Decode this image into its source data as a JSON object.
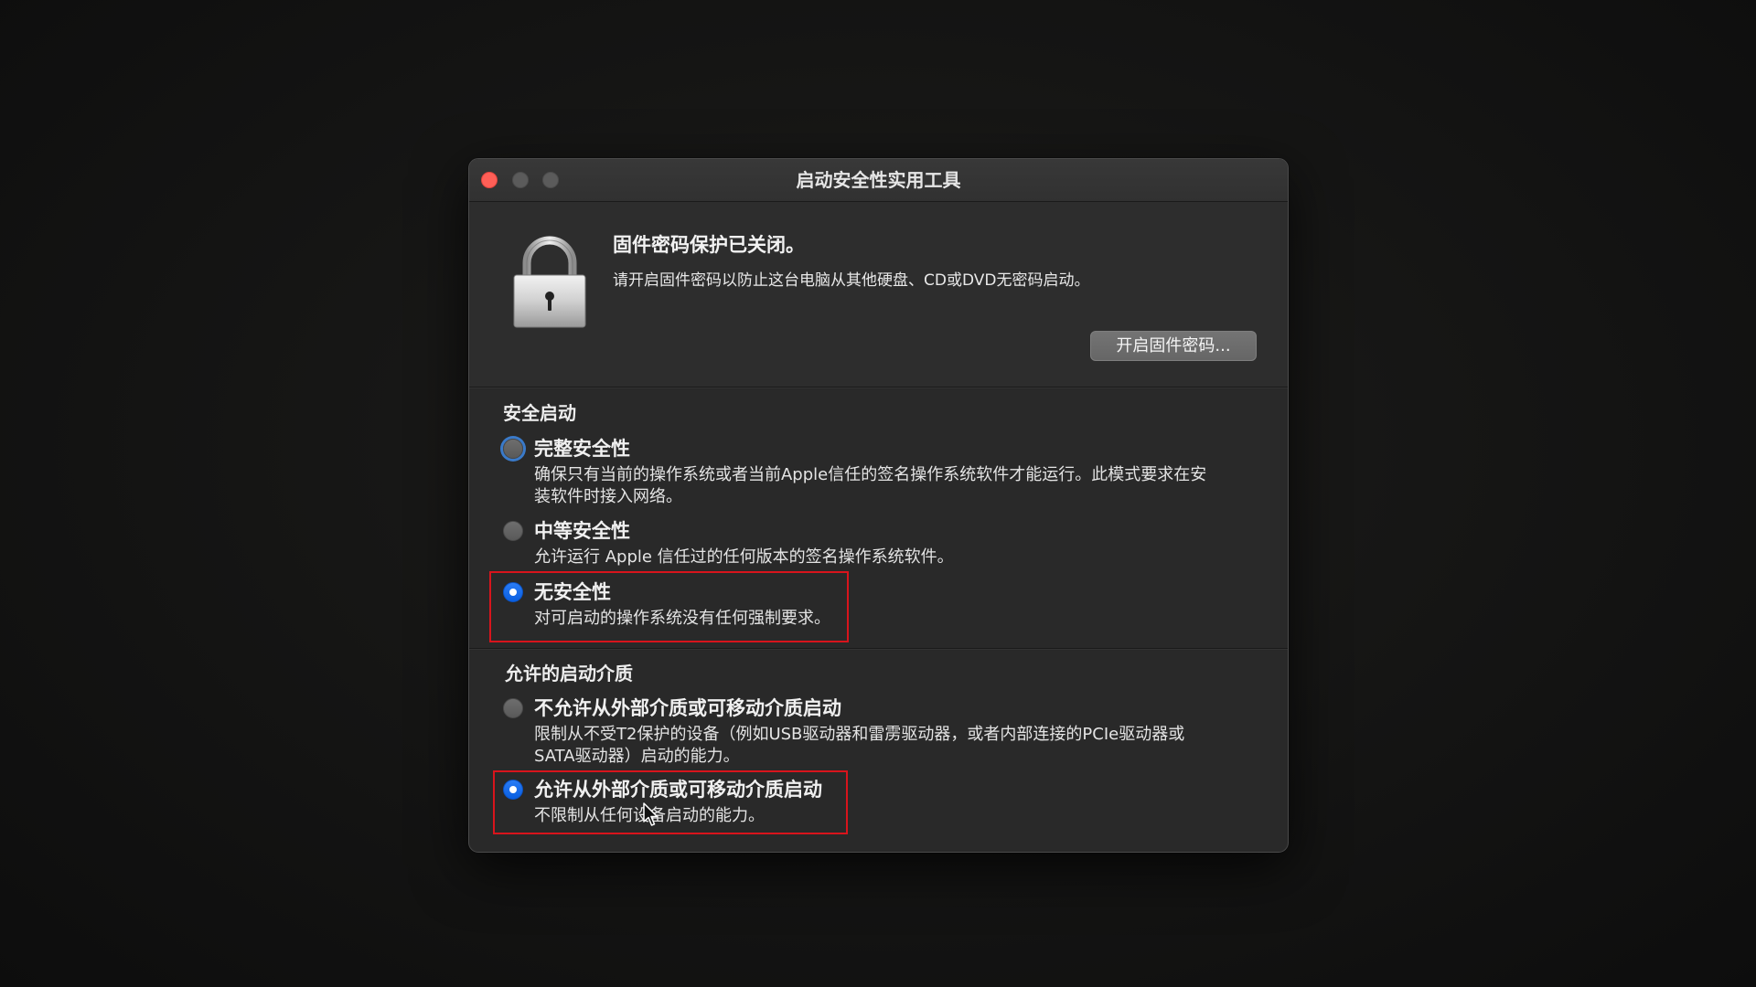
{
  "window": {
    "title": "启动安全性实用工具"
  },
  "firmware_password": {
    "heading": "固件密码保护已关闭。",
    "description": "请开启固件密码以防止这台电脑从其他硬盘、CD或DVD无密码启动。",
    "button_label": "开启固件密码..."
  },
  "secure_boot": {
    "title": "安全启动",
    "options": [
      {
        "label": "完整安全性",
        "description": [
          "确保只有当前的操作系统或者当前Apple信任的签名操作系统软件才能运行。此模式要求在安",
          "装软件时接入网络。"
        ],
        "selected": false,
        "focused": true
      },
      {
        "label": "中等安全性",
        "description": [
          "允许运行 Apple 信任过的任何版本的签名操作系统软件。"
        ],
        "selected": false,
        "focused": false
      },
      {
        "label": "无安全性",
        "description": [
          "对可启动的操作系统没有任何强制要求。"
        ],
        "selected": true,
        "focused": false
      }
    ]
  },
  "boot_media": {
    "title": "允许的启动介质",
    "options": [
      {
        "label": "不允许从外部介质或可移动介质启动",
        "description": [
          "限制从不受T2保护的设备（例如USB驱动器和雷雳驱动器，或者内部连接的PCIe驱动器或",
          "SATA驱动器）启动的能力。"
        ],
        "selected": false,
        "focused": false
      },
      {
        "label": "允许从外部介质或可移动介质启动",
        "description": [
          "不限制从任何设备启动的能力。"
        ],
        "selected": true,
        "focused": false
      }
    ]
  },
  "icons": {
    "window_close": "close-icon",
    "window_minimize": "minimize-icon",
    "window_zoom": "zoom-icon",
    "lock": "lock-icon",
    "pointer": "arrow-cursor-icon"
  },
  "colors": {
    "accent": "#0a5fe0",
    "close_button": "#ff5f57",
    "annotation_box": "#d8141c",
    "window_background": "#292929"
  }
}
